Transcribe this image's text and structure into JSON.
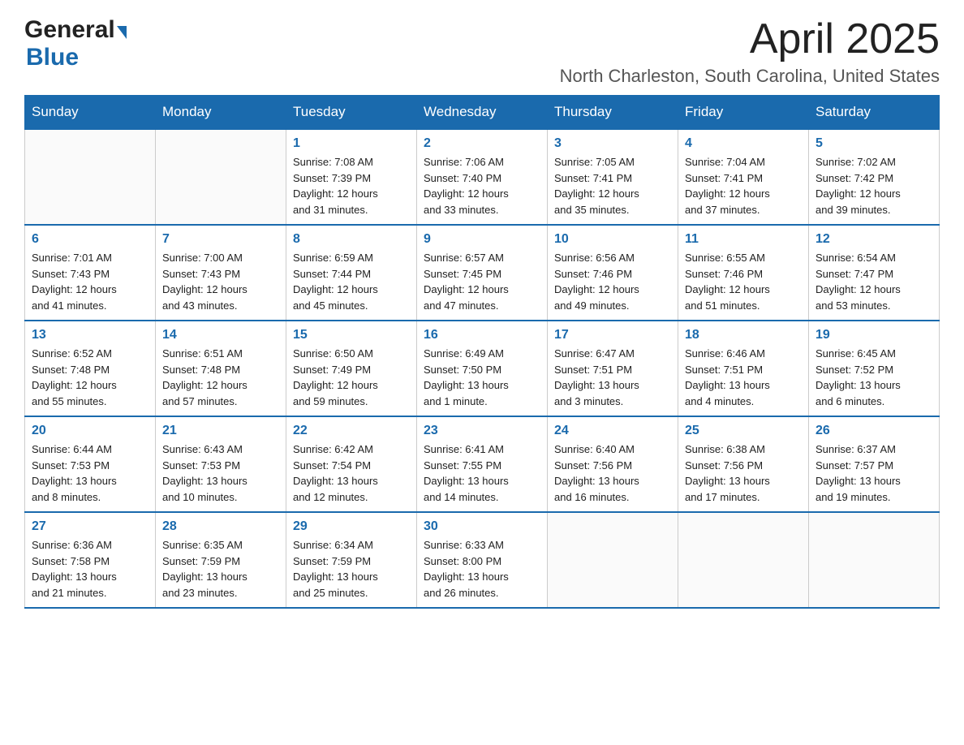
{
  "header": {
    "logo_general": "General",
    "logo_blue": "Blue",
    "month_title": "April 2025",
    "location": "North Charleston, South Carolina, United States"
  },
  "days_of_week": [
    "Sunday",
    "Monday",
    "Tuesday",
    "Wednesday",
    "Thursday",
    "Friday",
    "Saturday"
  ],
  "weeks": [
    [
      {
        "day": "",
        "info": ""
      },
      {
        "day": "",
        "info": ""
      },
      {
        "day": "1",
        "info": "Sunrise: 7:08 AM\nSunset: 7:39 PM\nDaylight: 12 hours\nand 31 minutes."
      },
      {
        "day": "2",
        "info": "Sunrise: 7:06 AM\nSunset: 7:40 PM\nDaylight: 12 hours\nand 33 minutes."
      },
      {
        "day": "3",
        "info": "Sunrise: 7:05 AM\nSunset: 7:41 PM\nDaylight: 12 hours\nand 35 minutes."
      },
      {
        "day": "4",
        "info": "Sunrise: 7:04 AM\nSunset: 7:41 PM\nDaylight: 12 hours\nand 37 minutes."
      },
      {
        "day": "5",
        "info": "Sunrise: 7:02 AM\nSunset: 7:42 PM\nDaylight: 12 hours\nand 39 minutes."
      }
    ],
    [
      {
        "day": "6",
        "info": "Sunrise: 7:01 AM\nSunset: 7:43 PM\nDaylight: 12 hours\nand 41 minutes."
      },
      {
        "day": "7",
        "info": "Sunrise: 7:00 AM\nSunset: 7:43 PM\nDaylight: 12 hours\nand 43 minutes."
      },
      {
        "day": "8",
        "info": "Sunrise: 6:59 AM\nSunset: 7:44 PM\nDaylight: 12 hours\nand 45 minutes."
      },
      {
        "day": "9",
        "info": "Sunrise: 6:57 AM\nSunset: 7:45 PM\nDaylight: 12 hours\nand 47 minutes."
      },
      {
        "day": "10",
        "info": "Sunrise: 6:56 AM\nSunset: 7:46 PM\nDaylight: 12 hours\nand 49 minutes."
      },
      {
        "day": "11",
        "info": "Sunrise: 6:55 AM\nSunset: 7:46 PM\nDaylight: 12 hours\nand 51 minutes."
      },
      {
        "day": "12",
        "info": "Sunrise: 6:54 AM\nSunset: 7:47 PM\nDaylight: 12 hours\nand 53 minutes."
      }
    ],
    [
      {
        "day": "13",
        "info": "Sunrise: 6:52 AM\nSunset: 7:48 PM\nDaylight: 12 hours\nand 55 minutes."
      },
      {
        "day": "14",
        "info": "Sunrise: 6:51 AM\nSunset: 7:48 PM\nDaylight: 12 hours\nand 57 minutes."
      },
      {
        "day": "15",
        "info": "Sunrise: 6:50 AM\nSunset: 7:49 PM\nDaylight: 12 hours\nand 59 minutes."
      },
      {
        "day": "16",
        "info": "Sunrise: 6:49 AM\nSunset: 7:50 PM\nDaylight: 13 hours\nand 1 minute."
      },
      {
        "day": "17",
        "info": "Sunrise: 6:47 AM\nSunset: 7:51 PM\nDaylight: 13 hours\nand 3 minutes."
      },
      {
        "day": "18",
        "info": "Sunrise: 6:46 AM\nSunset: 7:51 PM\nDaylight: 13 hours\nand 4 minutes."
      },
      {
        "day": "19",
        "info": "Sunrise: 6:45 AM\nSunset: 7:52 PM\nDaylight: 13 hours\nand 6 minutes."
      }
    ],
    [
      {
        "day": "20",
        "info": "Sunrise: 6:44 AM\nSunset: 7:53 PM\nDaylight: 13 hours\nand 8 minutes."
      },
      {
        "day": "21",
        "info": "Sunrise: 6:43 AM\nSunset: 7:53 PM\nDaylight: 13 hours\nand 10 minutes."
      },
      {
        "day": "22",
        "info": "Sunrise: 6:42 AM\nSunset: 7:54 PM\nDaylight: 13 hours\nand 12 minutes."
      },
      {
        "day": "23",
        "info": "Sunrise: 6:41 AM\nSunset: 7:55 PM\nDaylight: 13 hours\nand 14 minutes."
      },
      {
        "day": "24",
        "info": "Sunrise: 6:40 AM\nSunset: 7:56 PM\nDaylight: 13 hours\nand 16 minutes."
      },
      {
        "day": "25",
        "info": "Sunrise: 6:38 AM\nSunset: 7:56 PM\nDaylight: 13 hours\nand 17 minutes."
      },
      {
        "day": "26",
        "info": "Sunrise: 6:37 AM\nSunset: 7:57 PM\nDaylight: 13 hours\nand 19 minutes."
      }
    ],
    [
      {
        "day": "27",
        "info": "Sunrise: 6:36 AM\nSunset: 7:58 PM\nDaylight: 13 hours\nand 21 minutes."
      },
      {
        "day": "28",
        "info": "Sunrise: 6:35 AM\nSunset: 7:59 PM\nDaylight: 13 hours\nand 23 minutes."
      },
      {
        "day": "29",
        "info": "Sunrise: 6:34 AM\nSunset: 7:59 PM\nDaylight: 13 hours\nand 25 minutes."
      },
      {
        "day": "30",
        "info": "Sunrise: 6:33 AM\nSunset: 8:00 PM\nDaylight: 13 hours\nand 26 minutes."
      },
      {
        "day": "",
        "info": ""
      },
      {
        "day": "",
        "info": ""
      },
      {
        "day": "",
        "info": ""
      }
    ]
  ]
}
